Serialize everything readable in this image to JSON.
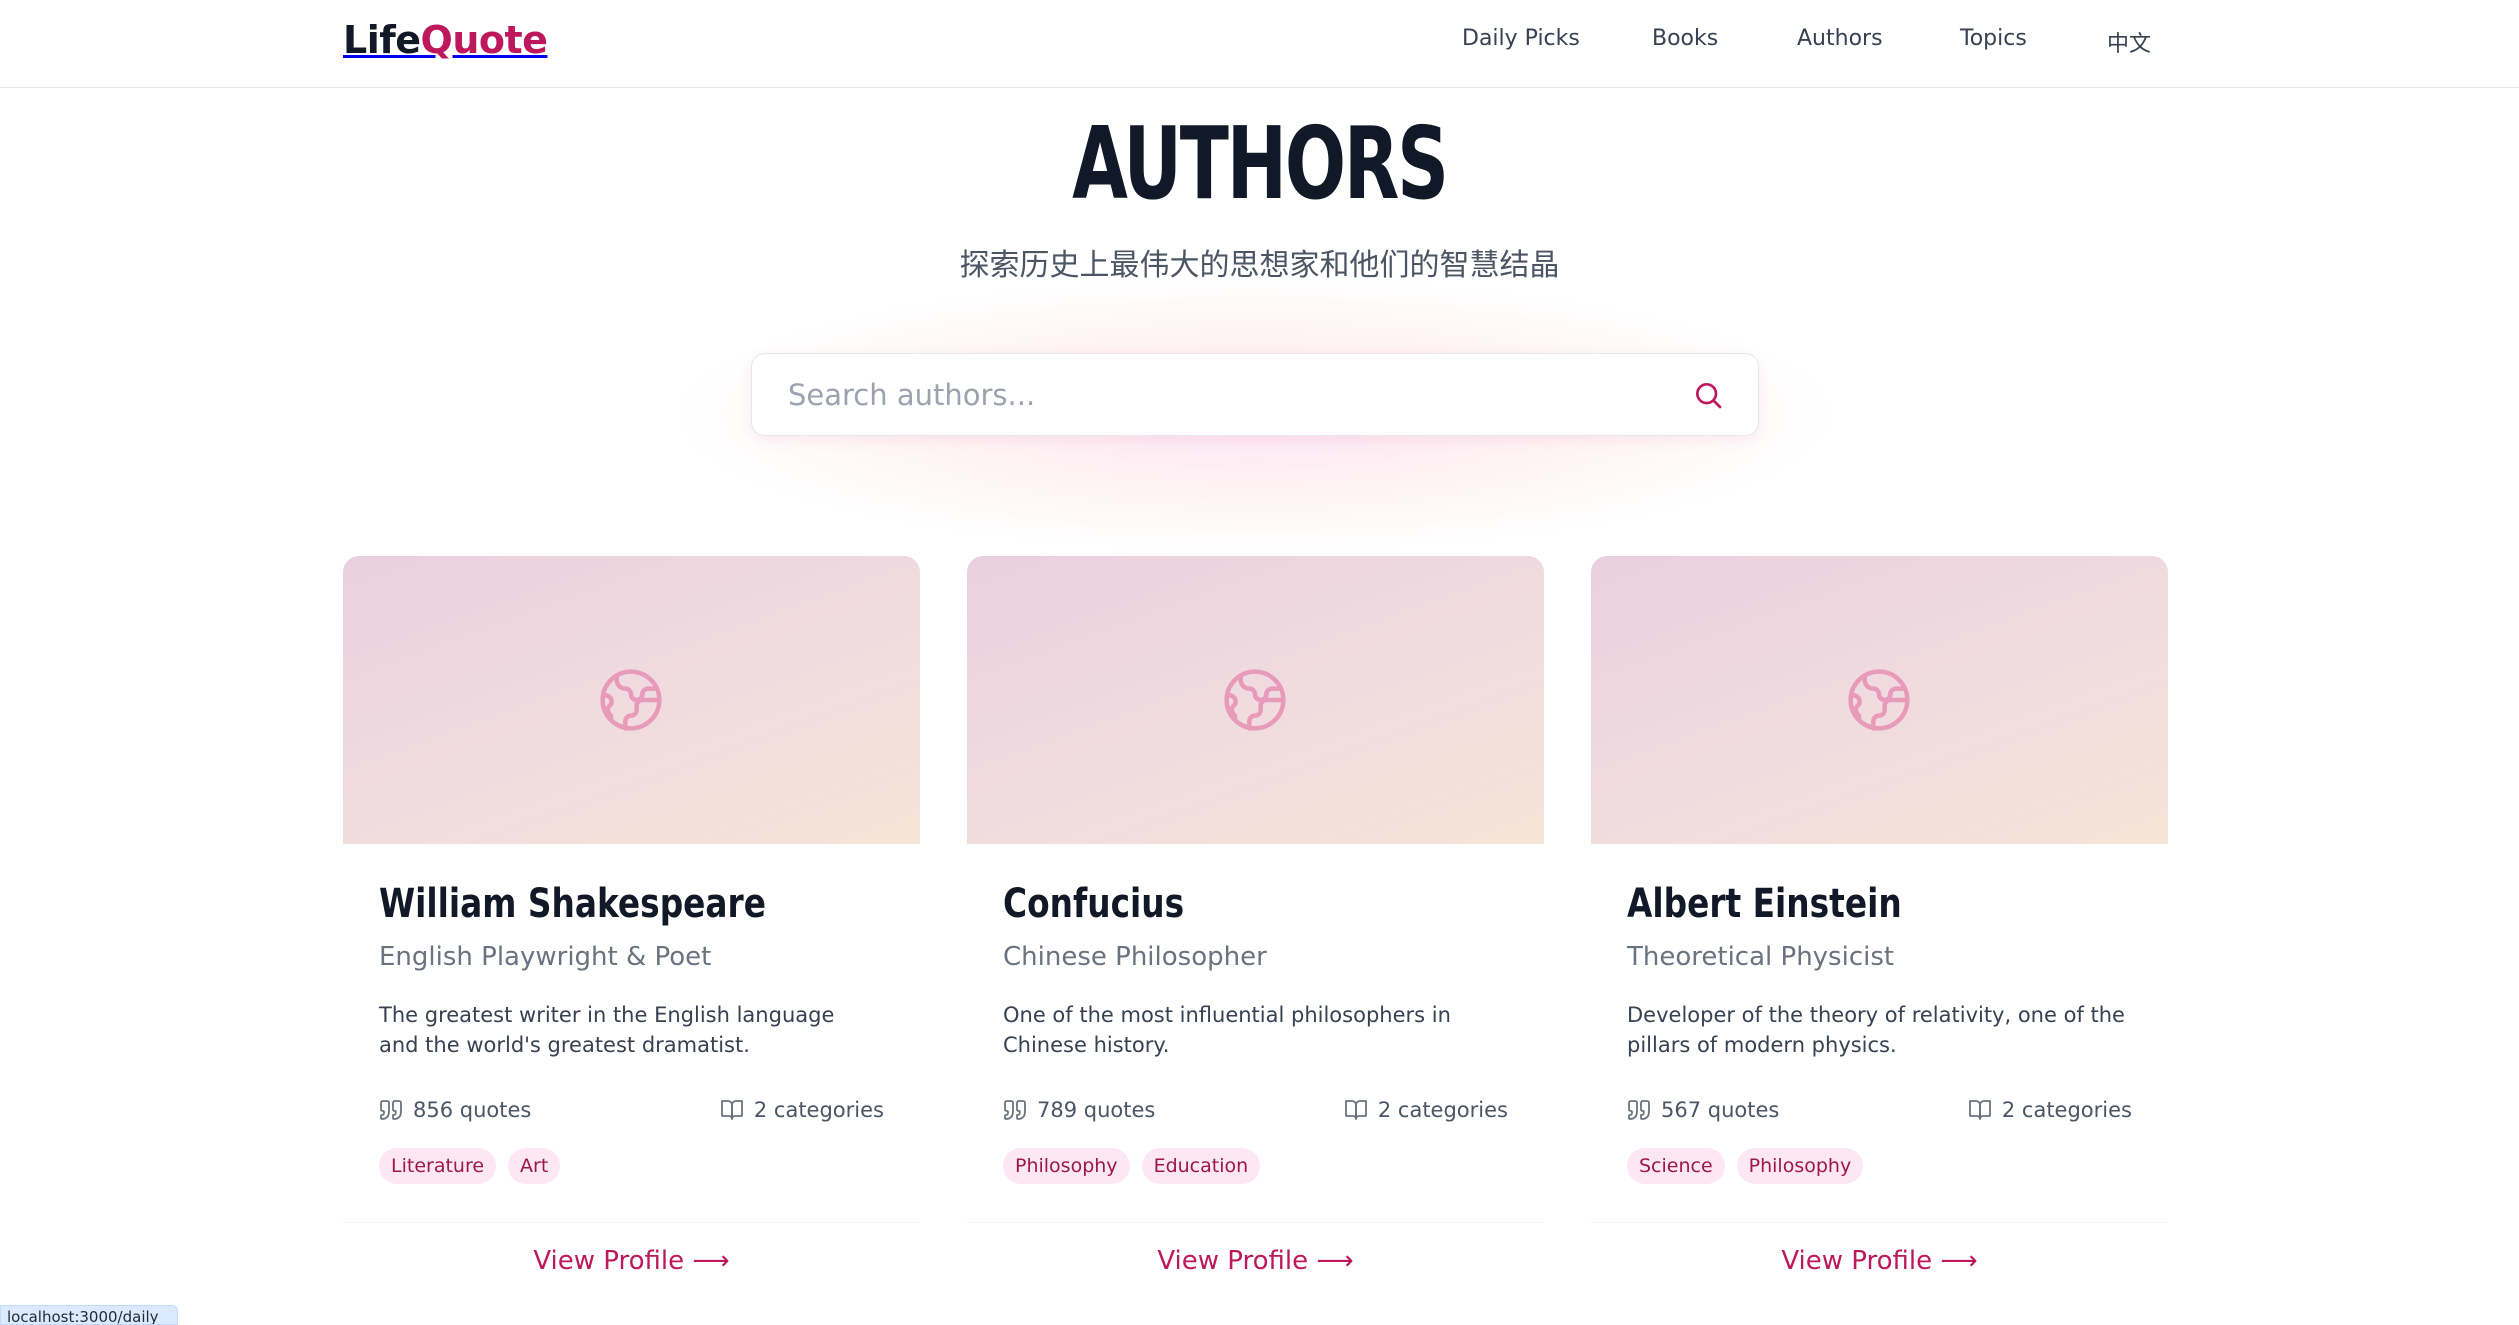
{
  "header": {
    "logo_part1": "Life",
    "logo_part2": "Quote",
    "nav": [
      "Daily Picks",
      "Books",
      "Authors",
      "Topics",
      "中文"
    ]
  },
  "hero": {
    "title": "AUTHORS",
    "subtitle": "探索历史上最伟大的思想家和他们的智慧结晶",
    "search_placeholder": "Search authors..."
  },
  "authors": [
    {
      "name": "William Shakespeare",
      "role": "English Playwright & Poet",
      "description": "The greatest writer in the English language and the world's greatest dramatist.",
      "quotes": "856 quotes",
      "categories": "2 categories",
      "tags": [
        "Literature",
        "Art"
      ],
      "link": "View Profile"
    },
    {
      "name": "Confucius",
      "role": "Chinese Philosopher",
      "description": "One of the most influential philosophers in Chinese history.",
      "quotes": "789 quotes",
      "categories": "2 categories",
      "tags": [
        "Philosophy",
        "Education"
      ],
      "link": "View Profile"
    },
    {
      "name": "Albert Einstein",
      "role": "Theoretical Physicist",
      "description": "Developer of the theory of relativity, one of the pillars of modern physics.",
      "quotes": "567 quotes",
      "categories": "2 categories",
      "tags": [
        "Science",
        "Philosophy"
      ],
      "link": "View Profile"
    }
  ],
  "status_url": "localhost:3000/daily",
  "colors": {
    "accent": "#be185d",
    "tag_bg": "#fce7f3",
    "text": "#111827"
  },
  "icons": {
    "search": "search-icon",
    "banner": "globe-icon",
    "quotes": "quote-icon",
    "categories": "book-icon",
    "arrow": "arrow-right-icon"
  }
}
